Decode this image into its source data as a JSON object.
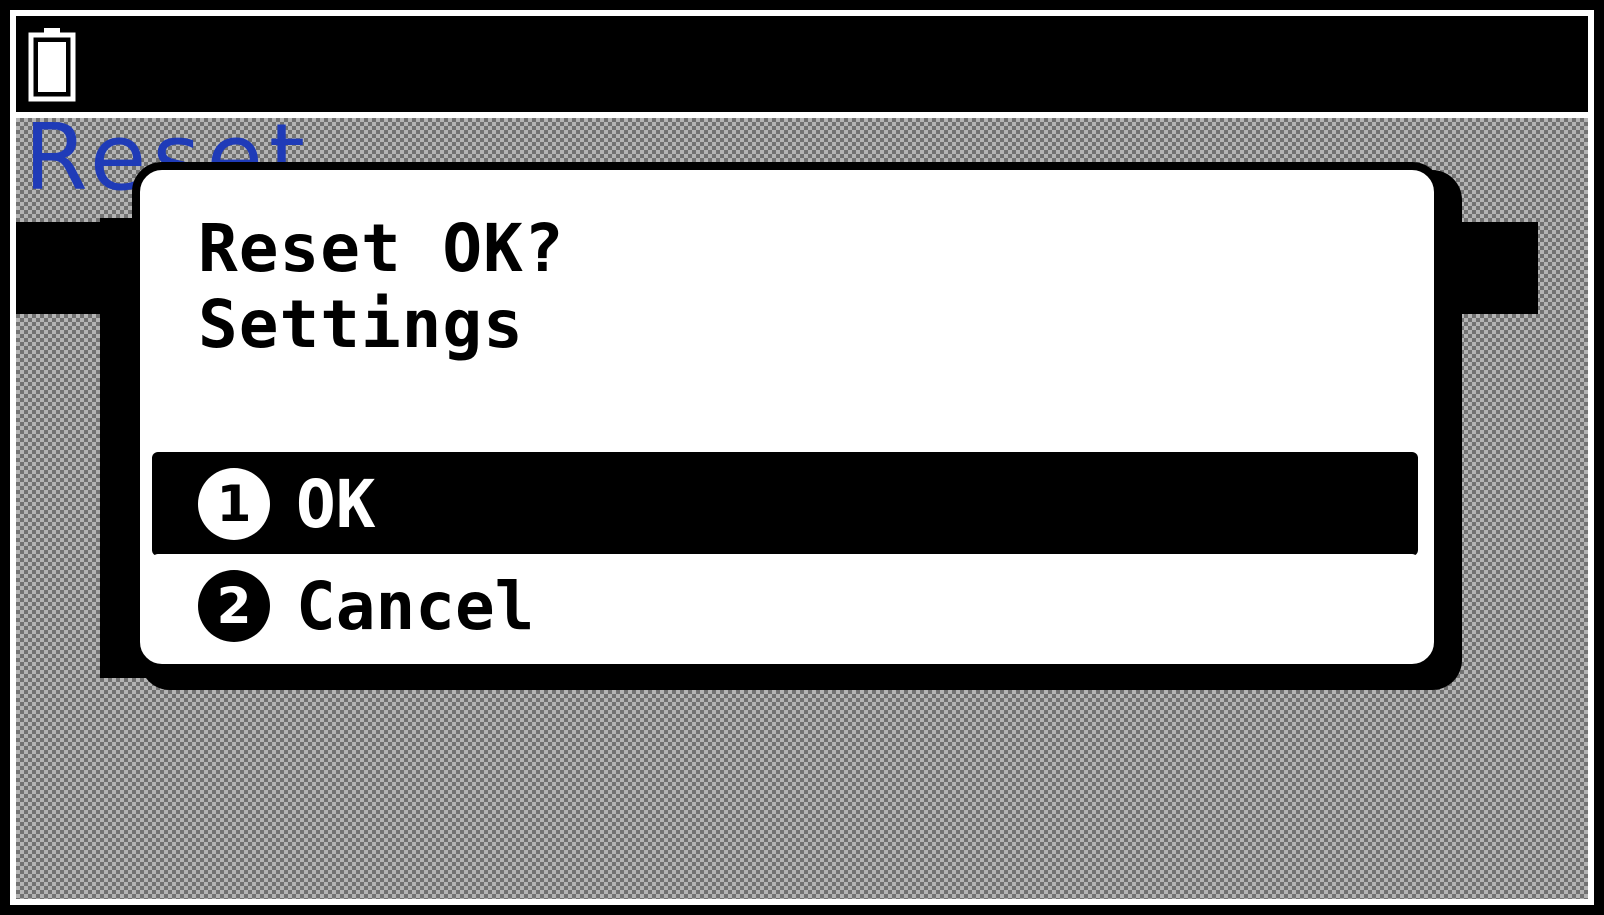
{
  "status_bar": {
    "battery_icon": "battery-icon"
  },
  "background": {
    "title": "Reset"
  },
  "dialog": {
    "line1": "Reset OK?",
    "line2": "Settings",
    "options": [
      {
        "number": "1",
        "label": "OK",
        "selected": true
      },
      {
        "number": "2",
        "label": "Cancel",
        "selected": false
      }
    ]
  },
  "colors": {
    "background_title": "#1f3bb8",
    "screen_ink": "#000000",
    "paper": "#ffffff"
  }
}
